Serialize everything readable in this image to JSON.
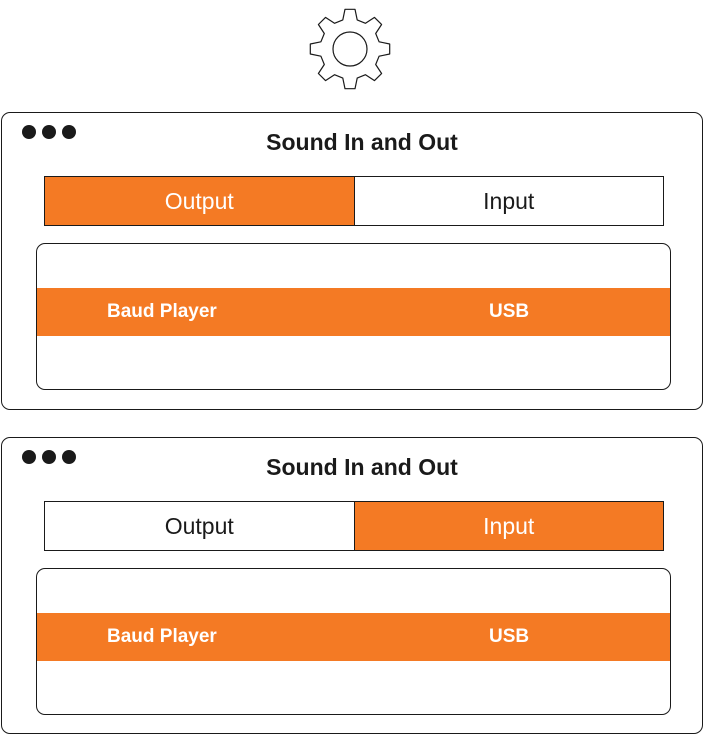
{
  "colors": {
    "accent": "#f47a24",
    "stroke": "#1a1a1a",
    "background": "#ffffff"
  },
  "settings_icon": "gear-icon",
  "windows": [
    {
      "title": "Sound In and Out",
      "selected_tab": "Output",
      "tabs": [
        {
          "label": "Output"
        },
        {
          "label": "Input"
        }
      ],
      "devices": [
        {
          "name": "Baud Player",
          "type": "USB"
        }
      ]
    },
    {
      "title": "Sound In and Out",
      "selected_tab": "Input",
      "tabs": [
        {
          "label": "Output"
        },
        {
          "label": "Input"
        }
      ],
      "devices": [
        {
          "name": "Baud Player",
          "type": "USB"
        }
      ]
    }
  ]
}
